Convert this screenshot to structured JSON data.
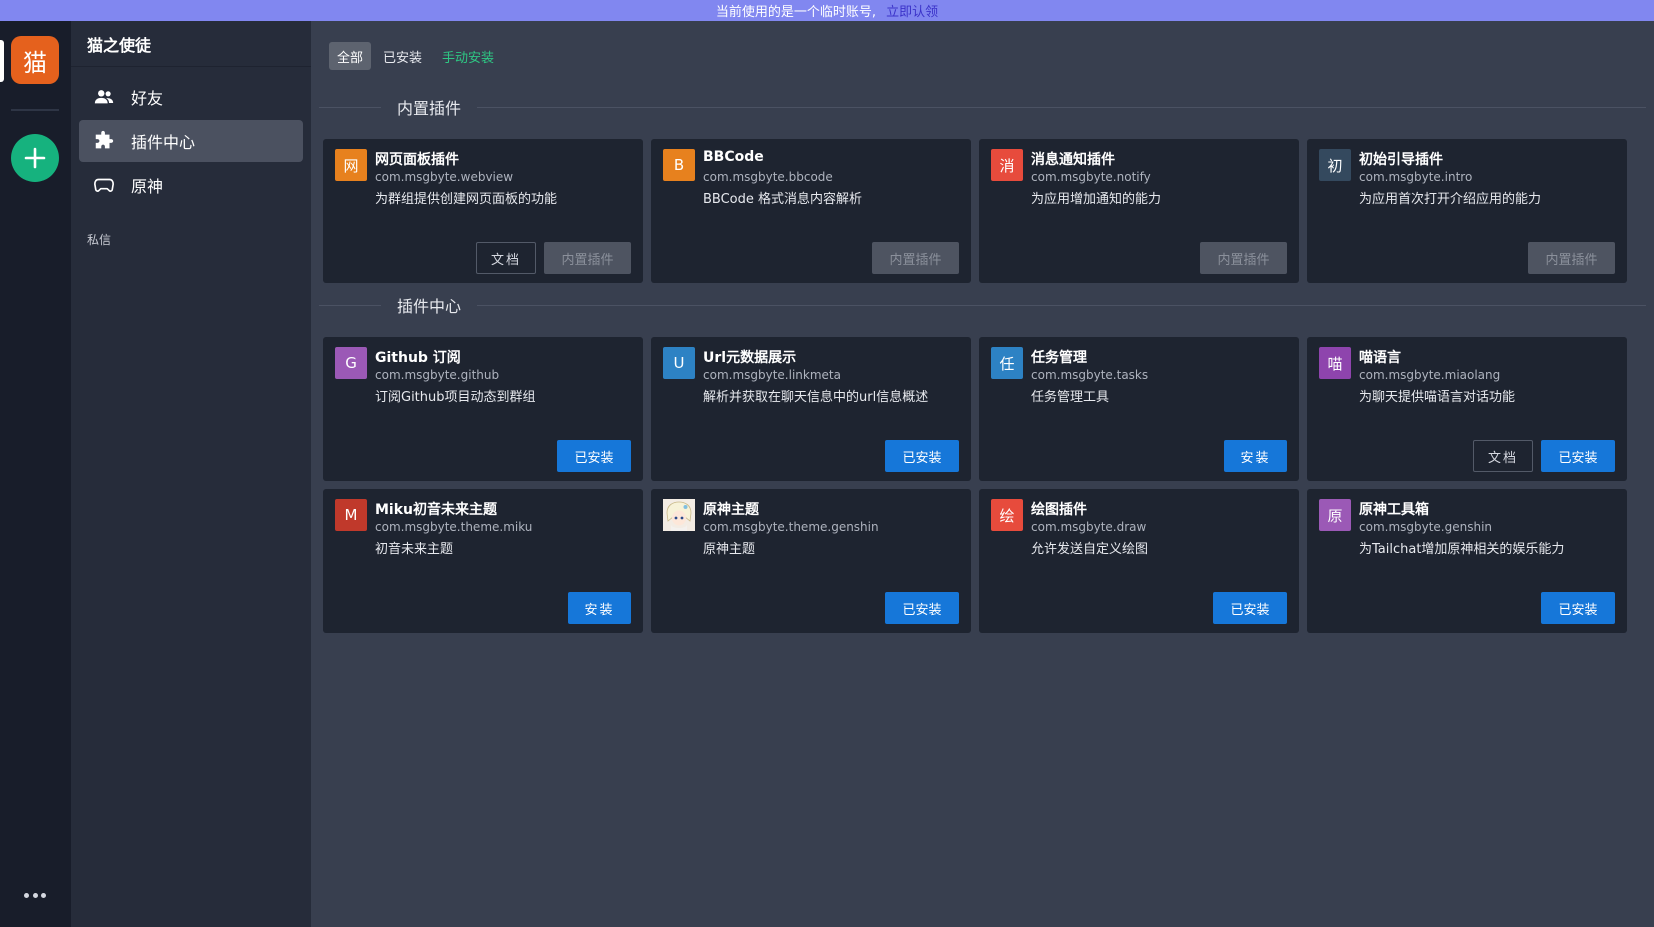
{
  "banner": {
    "text": "当前使用的是一个临时账号,",
    "claim": "立即认领"
  },
  "rail": {
    "logo_char": "猫",
    "add_icon": "plus-icon",
    "more_icon": "more-dots-icon"
  },
  "sidebar": {
    "title": "猫之使徒",
    "items": [
      {
        "label": "好友",
        "icon": "users-icon"
      },
      {
        "label": "插件中心",
        "icon": "puzzle-icon"
      },
      {
        "label": "原神",
        "icon": "gamepad-icon"
      }
    ],
    "section_label": "私信"
  },
  "tabs": [
    {
      "label": "全部"
    },
    {
      "label": "已安装"
    },
    {
      "label": "手动安装"
    }
  ],
  "sections": {
    "builtin": {
      "title": "内置插件",
      "cards": [
        {
          "icon_char": "网",
          "icon_color": "#e7811e",
          "name": "网页面板插件",
          "pkg": "com.msgbyte.webview",
          "desc": "为群组提供创建网页面板的功能",
          "doc": "文档",
          "action": "内置插件"
        },
        {
          "icon_char": "B",
          "icon_color": "#e7811e",
          "name": "BBCode",
          "pkg": "com.msgbyte.bbcode",
          "desc": "BBCode 格式消息内容解析",
          "action": "内置插件"
        },
        {
          "icon_char": "消",
          "icon_color": "#e74b3c",
          "name": "消息通知插件",
          "pkg": "com.msgbyte.notify",
          "desc": "为应用增加通知的能力",
          "action": "内置插件"
        },
        {
          "icon_char": "初",
          "icon_color": "#34495e",
          "name": "初始引导插件",
          "pkg": "com.msgbyte.intro",
          "desc": "为应用首次打开介绍应用的能力",
          "action": "内置插件"
        }
      ]
    },
    "center": {
      "title": "插件中心",
      "cards": [
        {
          "icon_char": "G",
          "icon_color": "#9b59b6",
          "name": "Github 订阅",
          "pkg": "com.msgbyte.github",
          "desc": "订阅Github项目动态到群组",
          "action": "已安装"
        },
        {
          "icon_char": "U",
          "icon_color": "#2d82c4",
          "name": "Url元数据展示",
          "pkg": "com.msgbyte.linkmeta",
          "desc": "解析并获取在聊天信息中的url信息概述",
          "action": "已安装"
        },
        {
          "icon_char": "任",
          "icon_color": "#2d82c4",
          "name": "任务管理",
          "pkg": "com.msgbyte.tasks",
          "desc": "任务管理工具",
          "action": "安装"
        },
        {
          "icon_char": "喵",
          "icon_color": "#8e44ad",
          "name": "喵语言",
          "pkg": "com.msgbyte.miaolang",
          "desc": "为聊天提供喵语言对话功能",
          "doc": "文档",
          "action": "已安装"
        },
        {
          "icon_char": "M",
          "icon_color": "#c0392b",
          "name": "Miku初音未来主题",
          "pkg": "com.msgbyte.theme.miku",
          "desc": "初音未来主题",
          "action": "安装"
        },
        {
          "icon_char": "",
          "icon_color": "#f0e6dc",
          "name": "原神主题",
          "pkg": "com.msgbyte.theme.genshin",
          "desc": "原神主题",
          "action": "已安装"
        },
        {
          "icon_char": "绘",
          "icon_color": "#e74b3c",
          "name": "绘图插件",
          "pkg": "com.msgbyte.draw",
          "desc": "允许发送自定义绘图",
          "action": "已安装"
        },
        {
          "icon_char": "原",
          "icon_color": "#9b59b6",
          "name": "原神工具箱",
          "pkg": "com.msgbyte.genshin",
          "desc": "为Tailchat增加原神相关的娱乐能力",
          "action": "已安装"
        }
      ]
    }
  }
}
